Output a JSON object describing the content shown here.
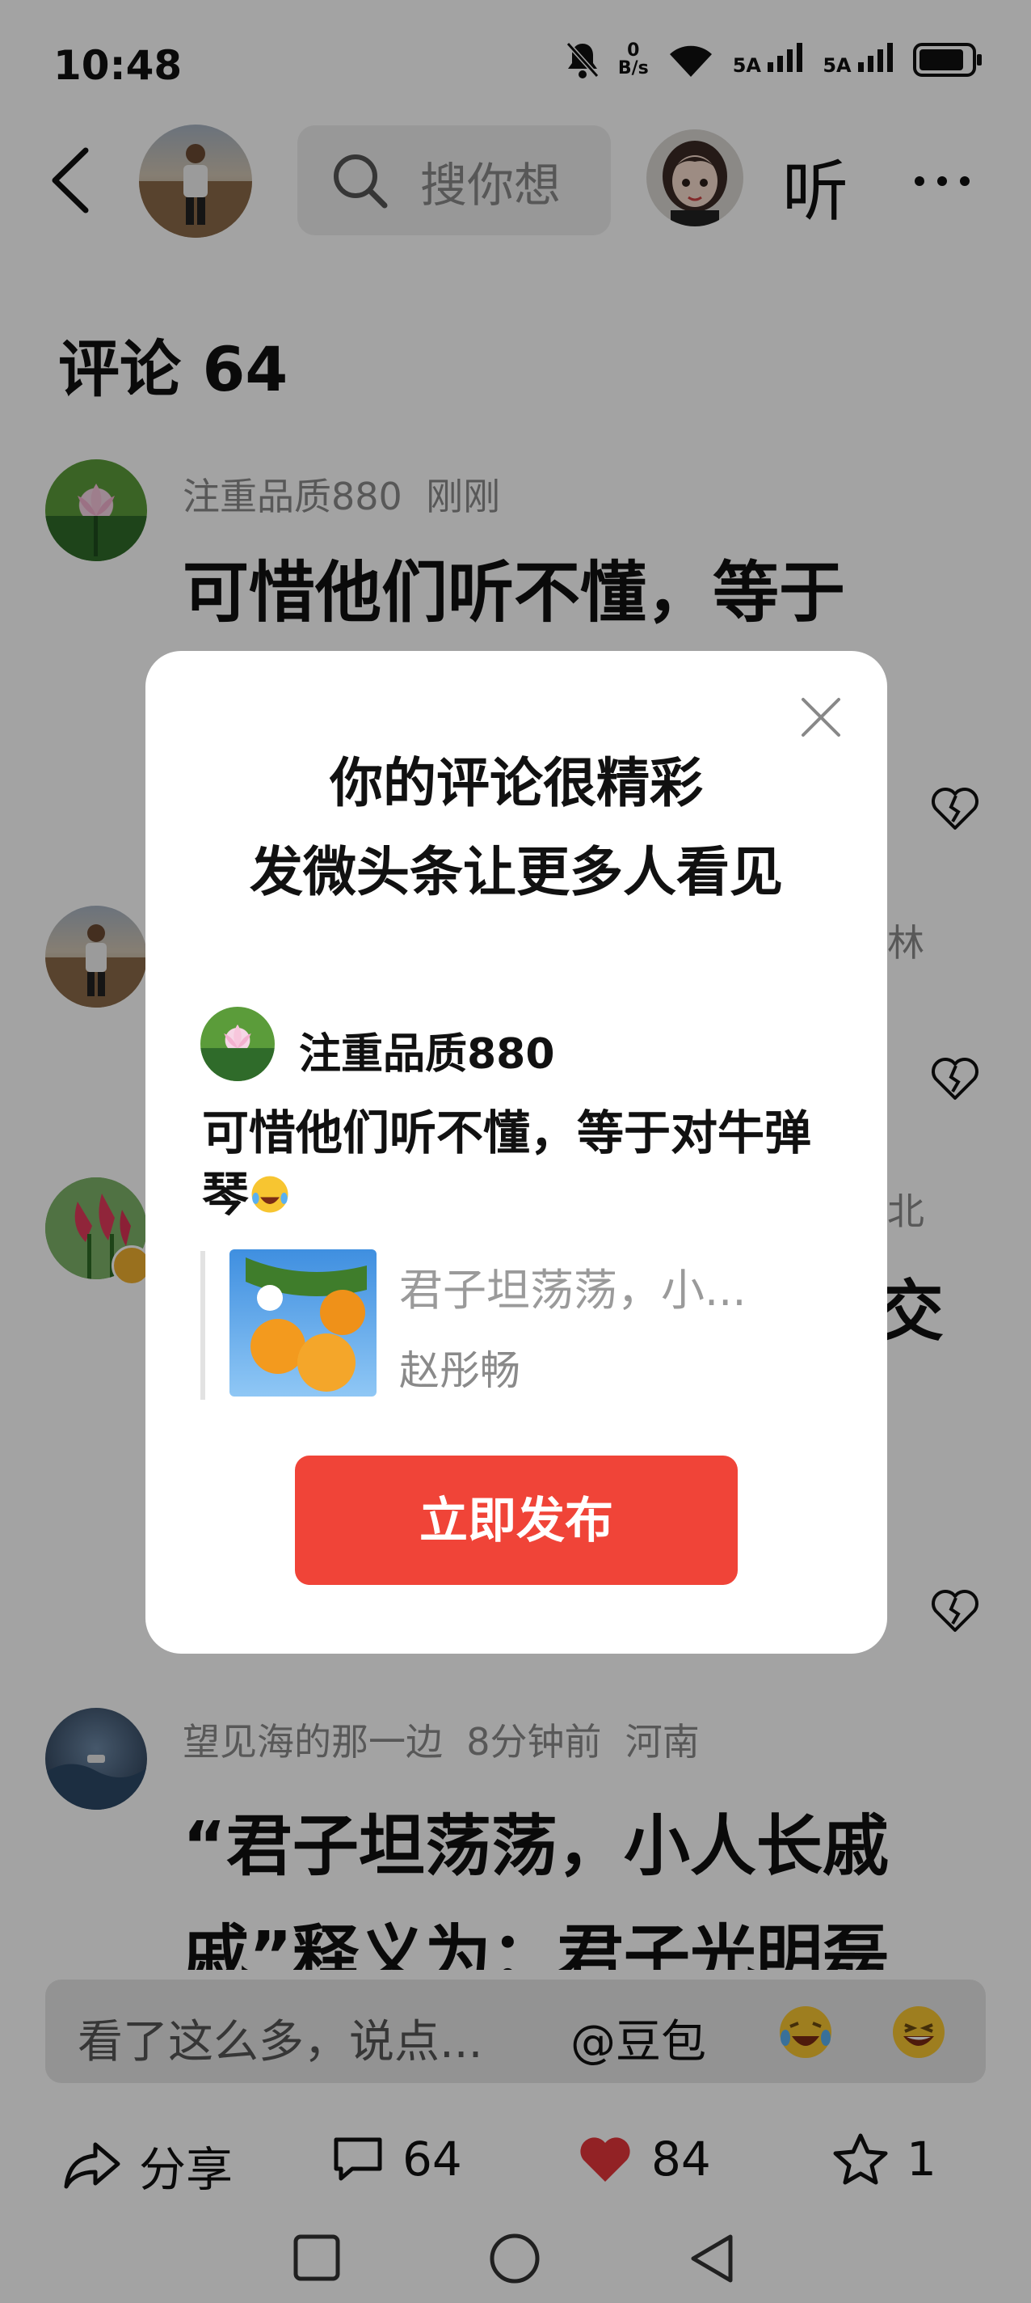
{
  "status_bar": {
    "time": "10:48",
    "net_speed_value": "0",
    "net_speed_unit": "B/s",
    "signal1": "5A",
    "signal2": "5A"
  },
  "header": {
    "search_placeholder": "搜你想",
    "listen_label": "听"
  },
  "comments_title": "评论 64",
  "comments": [
    {
      "user": "注重品质880",
      "time": "刚刚",
      "text": "可惜他们听不懂，等于"
    },
    {
      "meta_tail": "林"
    },
    {
      "meta_tail": "北",
      "text_tail": "交"
    },
    {
      "user": "望见海的那一边",
      "time": "8分钟前",
      "location": "河南",
      "text_line1": "“君子坦荡荡，小人长戚",
      "text_line2": "戚”释义为：君子光明磊"
    }
  ],
  "modal": {
    "title_line1": "你的评论很精彩",
    "title_line2": "发微头条让更多人看见",
    "user": "注重品质880",
    "comment": "可惜他们听不懂，等于对牛弹琴",
    "quote_title": "君子坦荡荡，小...",
    "quote_author": "赵彤畅",
    "publish_label": "立即发布"
  },
  "input_bar": {
    "placeholder": "看了这么多，说点...",
    "mention": "@豆包"
  },
  "bottom_bar": {
    "share_label": "分享",
    "comments_count": "64",
    "likes_count": "84",
    "favorites_count": "1"
  },
  "colors": {
    "accent_red": "#f04438",
    "heart_red": "#e5363a"
  }
}
